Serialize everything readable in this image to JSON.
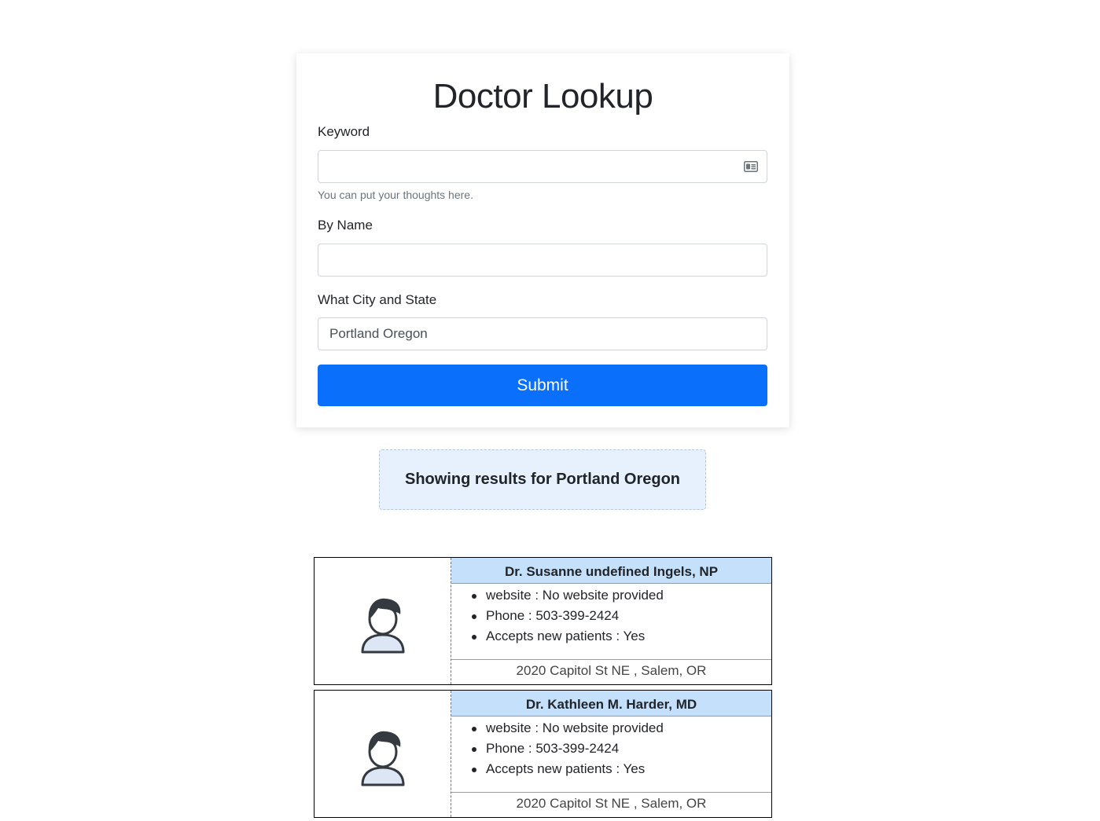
{
  "form": {
    "title": "Doctor Lookup",
    "keyword": {
      "label": "Keyword",
      "value": "",
      "help": "You can put your thoughts here.",
      "icon": "id-card-icon"
    },
    "name": {
      "label": "By Name",
      "value": ""
    },
    "city": {
      "label": "What City and State",
      "value": "Portland Oregon"
    },
    "submit_label": "Submit"
  },
  "results": {
    "banner": "Showing results for Portland Oregon",
    "doctors": [
      {
        "name": "Dr. Susanne undefined Ingels, NP",
        "website": "website : No website provided",
        "phone": "Phone : 503-399-2424",
        "accepts": "Accepts new patients : Yes",
        "address": "2020 Capitol St NE , Salem, OR",
        "avatar_icon": "person-icon"
      },
      {
        "name": "Dr. Kathleen M. Harder, MD",
        "website": "website : No website provided",
        "phone": "Phone : 503-399-2424",
        "accepts": "Accepts new patients : Yes",
        "address": "2020 Capitol St NE , Salem, OR",
        "avatar_icon": "person-icon"
      }
    ]
  },
  "colors": {
    "primary": "#0a6ffb",
    "banner_bg": "#e7f1fd",
    "name_header_bg": "#c4e0fb"
  }
}
